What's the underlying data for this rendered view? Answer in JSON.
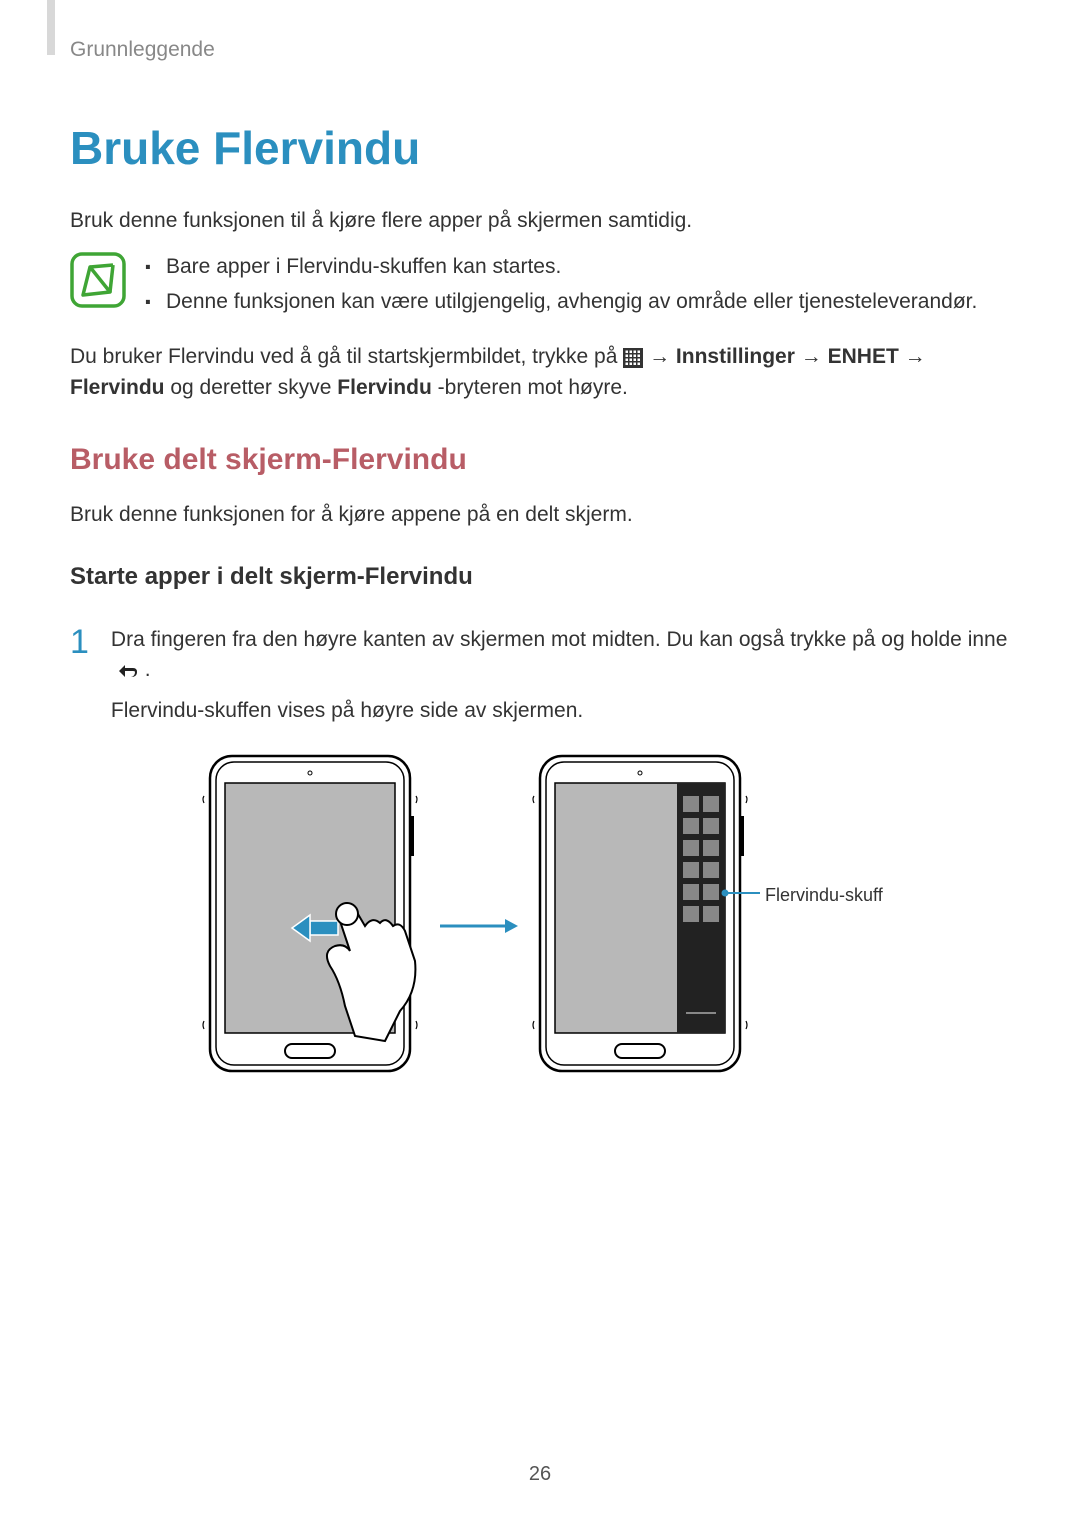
{
  "header": {
    "section": "Grunnleggende"
  },
  "title": "Bruke Flervindu",
  "intro": "Bruk denne funksjonen til å kjøre flere apper på skjermen samtidig.",
  "notes": {
    "item1": "Bare apper i Flervindu-skuffen kan startes.",
    "item2": "Denne funksjonen kan være utilgjengelig, avhengig av område eller tjenesteleverandør."
  },
  "instruction": {
    "part1": "Du bruker Flervindu ved å gå til startskjermbildet, trykke på ",
    "arrow1": " → ",
    "settings": "Innstillinger",
    "arrow2": " → ",
    "device": "ENHET",
    "arrow3": " → ",
    "part2a": "Flervindu",
    "part2b": " og deretter skyve ",
    "part2c": "Flervindu",
    "part2d": "-bryteren mot høyre."
  },
  "section2": {
    "title": "Bruke delt skjerm-Flervindu",
    "intro": "Bruk denne funksjonen for å kjøre appene på en delt skjerm.",
    "subheading": "Starte apper i delt skjerm-Flervindu"
  },
  "step1": {
    "number": "1",
    "text1": "Dra fingeren fra den høyre kanten av skjermen mot midten. Du kan også trykke på og holde inne ",
    "text1b": ".",
    "text2": "Flervindu-skuffen vises på høyre side av skjermen."
  },
  "callout": "Flervindu-skuff",
  "pageNumber": "26"
}
